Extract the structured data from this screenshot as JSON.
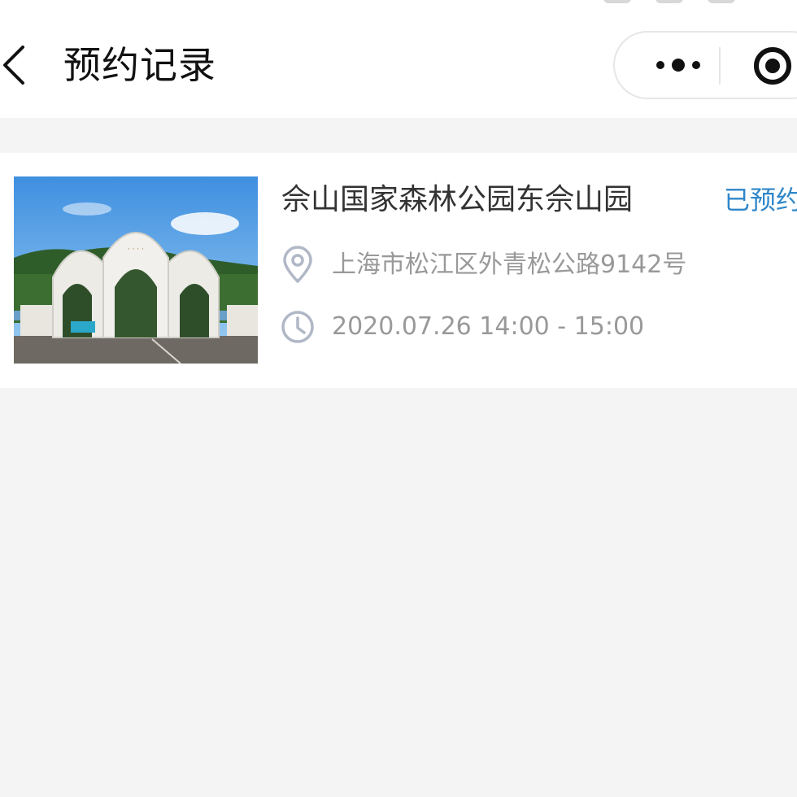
{
  "navbar": {
    "title": "预约记录",
    "back_icon": "chevron-left-icon",
    "more_icon": "more-dots-icon",
    "close_icon": "target-close-icon"
  },
  "reservations": [
    {
      "venue": "佘山国家森林公园东佘山园",
      "status": "已预约",
      "address": "上海市松江区外青松公路9142号",
      "time": "2020.07.26 14:00 - 15:00",
      "image_icon": "park-gate-image",
      "location_icon": "location-pin-icon",
      "time_icon": "clock-icon"
    }
  ],
  "colors": {
    "background": "#f4f4f4",
    "card": "#ffffff",
    "title_text": "#111111",
    "status_accent": "#2f86c9",
    "secondary_text": "#999999",
    "icon_gray": "#b0b7c6"
  }
}
